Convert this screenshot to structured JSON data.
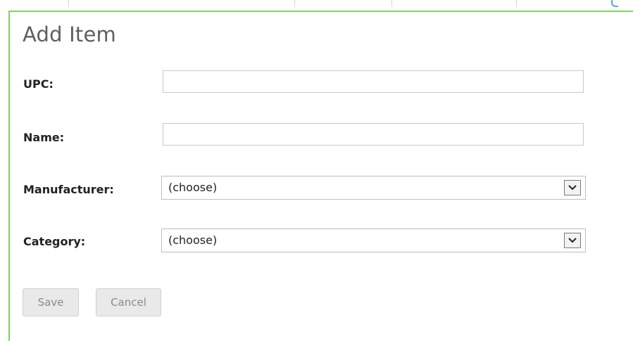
{
  "form": {
    "title": "Add Item",
    "upc_label": "UPC:",
    "upc_value": "",
    "name_label": "Name:",
    "name_value": "",
    "manufacturer_label": "Manufacturer:",
    "manufacturer_selected": "(choose)",
    "category_label": "Category:",
    "category_selected": "(choose)",
    "save_label": "Save",
    "cancel_label": "Cancel"
  },
  "theme": {
    "panel_border_color": "#7ed35b",
    "tab_accent_color": "#5aa4d6",
    "dropdown_icon": "chevron-down-icon"
  }
}
